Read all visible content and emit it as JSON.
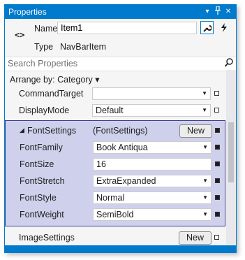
{
  "window": {
    "title": "Properties",
    "buttons": [
      "chevron-down-icon",
      "pin-icon",
      "close-icon"
    ]
  },
  "header": {
    "icon": "code-icon",
    "name_label": "Name",
    "name_value": "Item1",
    "type_label": "Type",
    "type_value": "NavBarItem",
    "properties_button": "wrench-icon",
    "events_button": "lightning-icon"
  },
  "search": {
    "placeholder": "Search Properties",
    "icon": "search-icon"
  },
  "arrange": {
    "label": "Arrange by: Category",
    "dropdown": "▾"
  },
  "properties": [
    {
      "name": "CommandTarget",
      "value": "",
      "dropdown": true
    },
    {
      "name": "DisplayMode",
      "value": "Default",
      "dropdown": true
    },
    {
      "name": "FontSettings",
      "value": "(FontSettings)",
      "button": "New",
      "expanded": true,
      "expander": "◢"
    },
    {
      "name": "FontFamily",
      "value": "Book Antiqua",
      "dropdown": true
    },
    {
      "name": "FontSize",
      "value": "16",
      "dropdown": false
    },
    {
      "name": "FontStretch",
      "value": "ExtraExpanded",
      "dropdown": true
    },
    {
      "name": "FontStyle",
      "value": "Normal",
      "dropdown": true
    },
    {
      "name": "FontWeight",
      "value": "SemiBold",
      "dropdown": true
    },
    {
      "name": "ImageSettings",
      "value": "",
      "button": "New"
    }
  ],
  "colors": {
    "accent": "#007acc",
    "group_bg": "#cfd1ec",
    "group_border": "#3c3c96"
  },
  "glyphs": {
    "dropdown": "▼",
    "chevron": "▾",
    "pin": "📌",
    "close": "✕",
    "wrench": "🔧",
    "lightning": "⚡",
    "search": "⌕",
    "code": "<>"
  }
}
